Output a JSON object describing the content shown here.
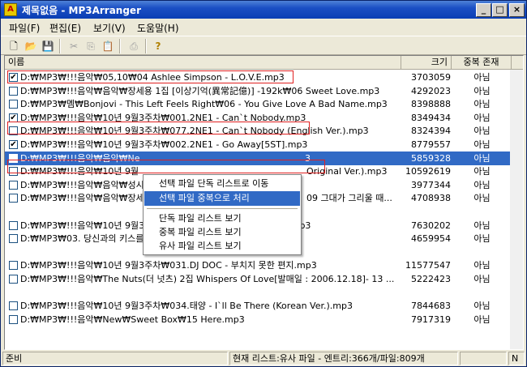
{
  "window": {
    "title": "제목없음 - MP3Arranger",
    "app_icon": "A",
    "controls": {
      "minimize": "_",
      "maximize": "□",
      "close": "×"
    }
  },
  "menubar": {
    "items": [
      "파일(F)",
      "편집(E)",
      "보기(V)",
      "도움말(H)"
    ]
  },
  "toolbar": {
    "icons": [
      "new-file-icon",
      "open-folder-icon",
      "save-icon",
      "cut-icon",
      "copy-icon",
      "paste-icon",
      "print-icon",
      "help-icon"
    ],
    "glyphs": {
      "new": "🗋",
      "open": "📂",
      "save": "💾",
      "cut": "✂",
      "copy": "⎘",
      "paste": "📋",
      "print": "⎙",
      "help": "?"
    }
  },
  "list": {
    "columns": {
      "name": "이름",
      "size": "크기",
      "dup": "중복 존재"
    },
    "rows": [
      {
        "checked": true,
        "name": "D:₩MP3₩!!!음악₩05,10₩04  Ashlee Simpson - L.O.V.E.mp3",
        "size": "3703059",
        "dup": "아님"
      },
      {
        "checked": false,
        "name": "D:₩MP3₩!!!음악₩음악₩장세용 1집 [이상기억(異常記億)] -192k₩06 Sweet Love.mp3",
        "size": "4292023",
        "dup": "아님"
      },
      {
        "checked": false,
        "name": "D:₩MP3₩멤₩Bonjovi - This Left Feels Right₩06 - You Give Love A Bad Name.mp3",
        "size": "8398888",
        "dup": "아님"
      },
      {
        "checked": true,
        "name": "D:₩MP3₩!!!음악₩10년 9월3주차₩001.2NE1 - Can`t Nobody.mp3",
        "size": "8349434",
        "dup": "아님"
      },
      {
        "checked": false,
        "name": "D:₩MP3₩!!!음악₩10년 9월3주차₩077.2NE1 - Can`t Nobody (English Ver.).mp3",
        "size": "8324394",
        "dup": "아님"
      },
      {
        "checked": true,
        "name": "D:₩MP3₩!!!음악₩10년 9월3주차₩002.2NE1 - Go Away[5ST].mp3",
        "size": "8779557",
        "dup": "아님"
      },
      {
        "checked": false,
        "name": "D:₩MP3₩!!!음악₩음악₩Ne",
        "size": "5859328",
        "dup": "아님",
        "suffix": "3"
      },
      {
        "checked": false,
        "name": "D:₩MP3₩!!!음악₩10년 9월",
        "size": "10592619",
        "dup": "아님",
        "suffix": "Original Ver.).mp3"
      },
      {
        "checked": false,
        "name": "D:₩MP3₩!!!음악₩음악₩성시",
        "size": "3977344",
        "dup": "아님",
        "suffix": ""
      },
      {
        "checked": false,
        "name": "D:₩MP3₩!!!음악₩음악₩장세",
        "size": "4708938",
        "dup": "아님",
        "suffix": "09 그대가 그리울 때..."
      },
      {
        "checked": false,
        "name": "",
        "size": "",
        "dup": ""
      },
      {
        "checked": false,
        "name": "D:₩MP3₩!!!음악₩10년 9월3주차₩023.보아 - Hurricane Venus.mp3",
        "size": "7630202",
        "dup": "아님"
      },
      {
        "checked": false,
        "name": "D:₩MP3₩03. 당신과의 키스를 세어보아요.mp3",
        "size": "4659954",
        "dup": "아님"
      },
      {
        "checked": false,
        "name": "",
        "size": "",
        "dup": ""
      },
      {
        "checked": false,
        "name": "D:₩MP3₩!!!음악₩10년 9월3주차₩031.DJ DOC - 부치지 못한 편지.mp3",
        "size": "11577547",
        "dup": "아님"
      },
      {
        "checked": false,
        "name": "D:₩MP3₩!!!음악₩The Nuts(더 넛츠) 2집 Whispers Of Love[발매일 : 2006.12.18]- 13 ...",
        "size": "5222423",
        "dup": "아님"
      },
      {
        "checked": false,
        "name": "",
        "size": "",
        "dup": ""
      },
      {
        "checked": false,
        "name": "D:₩MP3₩!!!음악₩10년 9월3주차₩034.태양 - I`ll Be There (Korean Ver.).mp3",
        "size": "7844683",
        "dup": "아님"
      },
      {
        "checked": false,
        "name": "D:₩MP3₩!!!음악₩New₩Sweet Box₩15 Here.mp3",
        "size": "7917319",
        "dup": "아님"
      }
    ]
  },
  "context_menu": {
    "items": [
      {
        "label": "선택 파일 단독 리스트로 이동",
        "highlighted": false
      },
      {
        "label": "선택 파일 중복으로 처리",
        "highlighted": true
      },
      {
        "label": "단독 파일 리스트 보기",
        "highlighted": false
      },
      {
        "label": "중복 파일 리스트 보기",
        "highlighted": false
      },
      {
        "label": "유사 파일 리스트 보기",
        "highlighted": false
      }
    ]
  },
  "status": {
    "left": "준비",
    "middle": "현재 리스트:유사 파일 - 엔트리:366개/파일:809개",
    "right1": "",
    "right2": "N"
  }
}
